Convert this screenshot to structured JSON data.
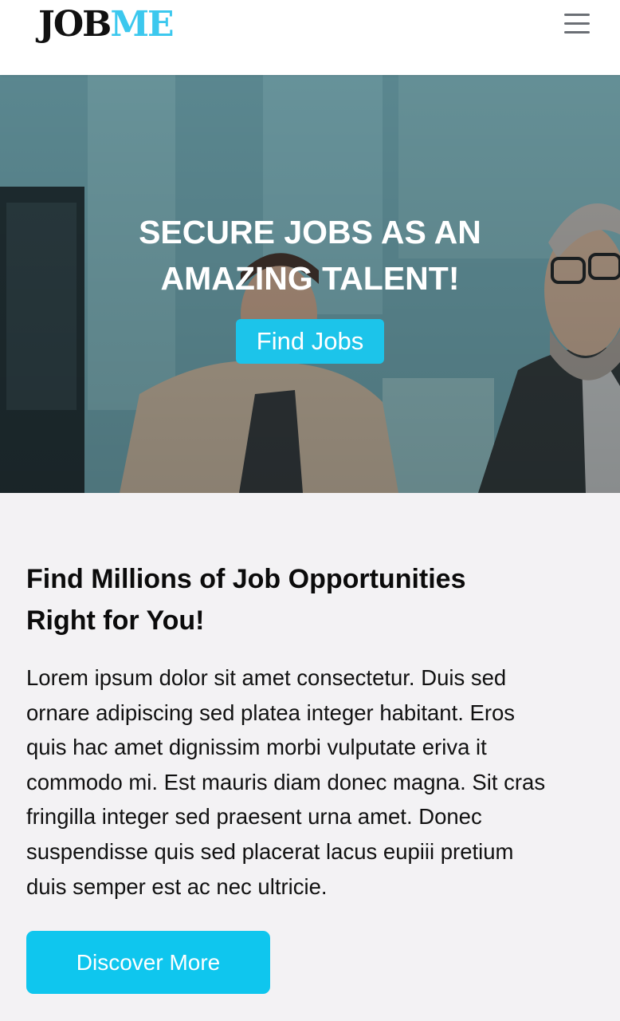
{
  "header": {
    "logo_part1": "JOB",
    "logo_part2": "ME",
    "menu_icon": "hamburger-menu-icon"
  },
  "hero": {
    "title": "SECURE JOBS AS AN\nAMAZING TALENT!",
    "cta_label": "Find Jobs"
  },
  "intro": {
    "title": "Find Millions of Job Opportunities\nRight for You!",
    "body": "Lorem ipsum dolor sit amet consectetur. Duis sed\nornare adipiscing sed platea integer habitant. Eros\nquis hac amet dignissim morbi vulputate eriva it\ncommodo mi. Est mauris diam donec magna. Sit cras\nfringilla integer sed praesent urna amet. Donec\nsuspendisse quis sed placerat lacus eupiii pretium\nduis semper est ac nec ultricie.",
    "cta_label": "Discover More"
  },
  "colors": {
    "accent": "#1cc4ea",
    "logo_accent": "#3cc8ee",
    "page_background": "#f3f2f4"
  }
}
